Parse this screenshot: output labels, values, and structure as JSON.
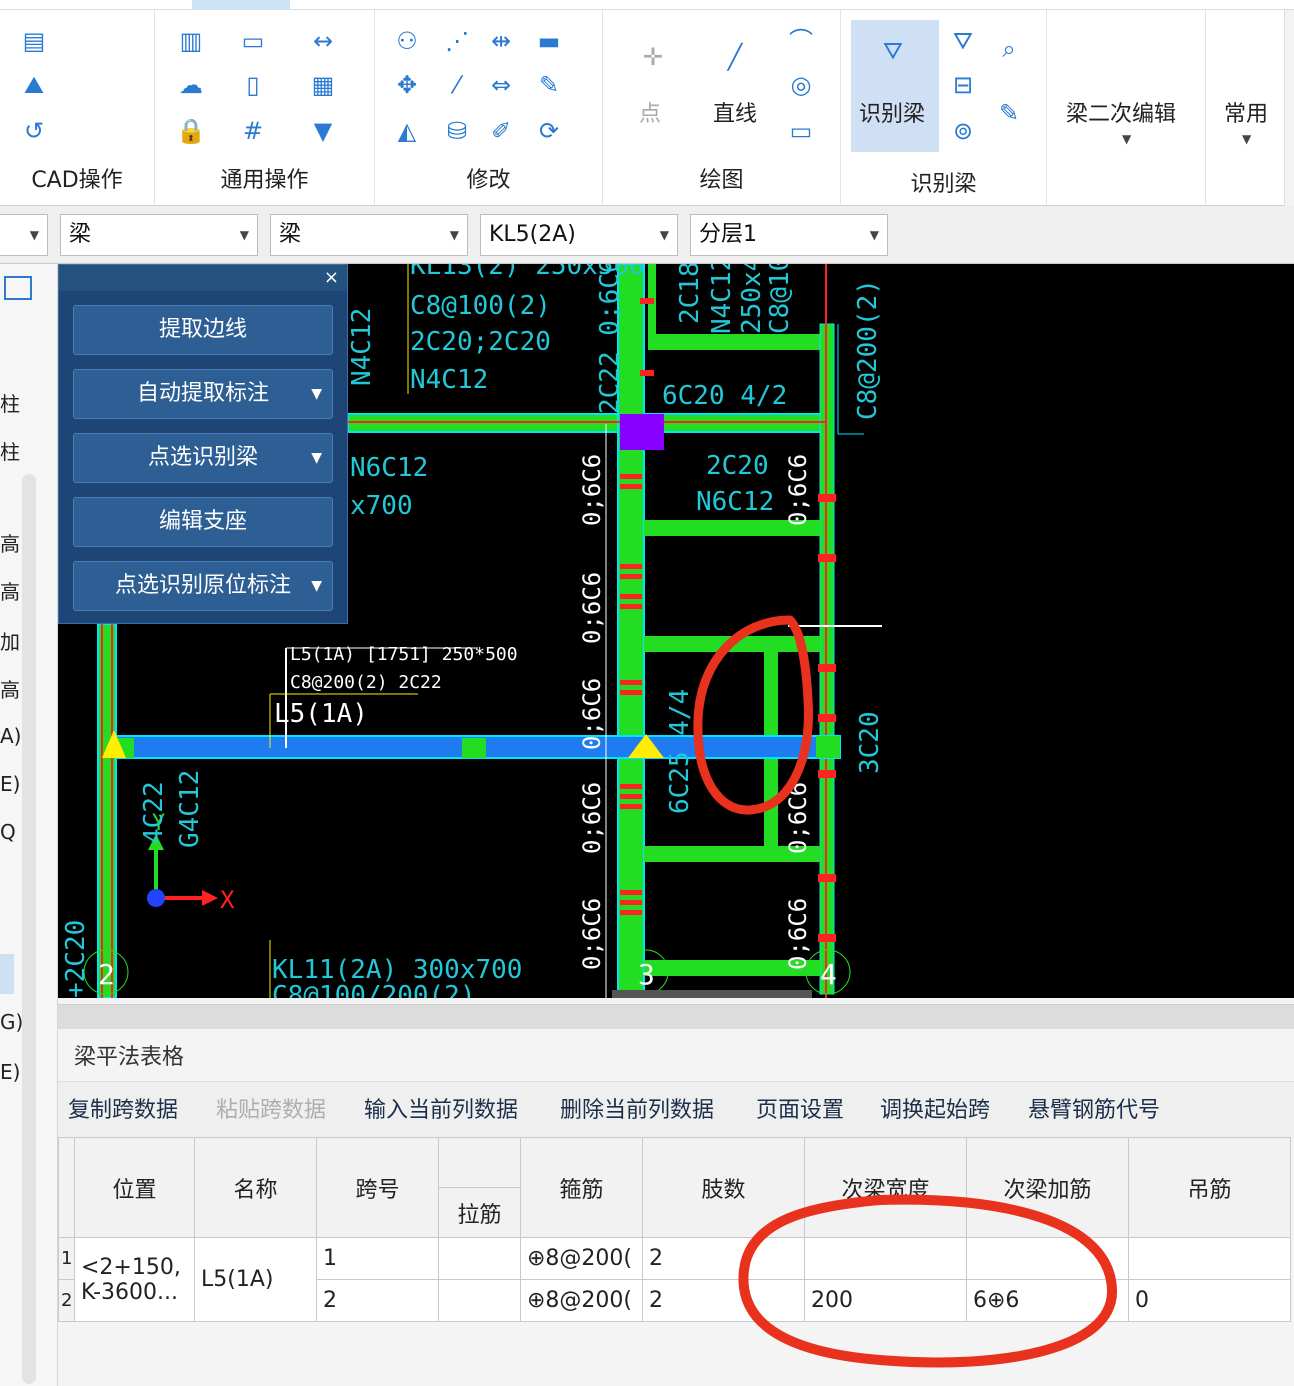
{
  "ribbon": {
    "groups": {
      "cad": "CAD操作",
      "general": "通用操作",
      "modify": "修改",
      "draw": "绘图",
      "identify": "识别梁"
    },
    "buttons": {
      "point": "点",
      "line": "直线",
      "identify_beam": "识别梁",
      "beam_secondary_edit": "梁二次编辑",
      "common": "常用"
    }
  },
  "combos": [
    "梁",
    "梁",
    "KL5(2A)",
    "分层1"
  ],
  "left_fragments": [
    "柱",
    "柱",
    "高",
    "高",
    "加",
    "高",
    "A)",
    "E)",
    "Q",
    "G)",
    "E)"
  ],
  "panel": {
    "close": "×",
    "buttons": [
      "提取边线",
      "自动提取标注",
      "点选识别梁",
      "编辑支座",
      "点选识别原位标注"
    ]
  },
  "canvas_text": {
    "t1": "KL13(2) 250x500",
    "t2": "C8@100(2)",
    "t3": "2C20;2C20",
    "t4": "N4C12",
    "t5": "N4C12",
    "t6": "2C22 0;6C6",
    "t7": "6C20 4/2",
    "t8": "2C18",
    "t9": "N4C12",
    "t10": "250x4",
    "t11": "C8@10",
    "t12": "C8@200(2)",
    "t13": "N6C12",
    "t14": "x700",
    "t15": "2C20",
    "t16": "N6C12",
    "t17": "0;6C6",
    "t18": "0;6C6",
    "t19": "0;6C6",
    "t20": "0;6C6",
    "t21": "0;6C6",
    "t22": "0;6C6",
    "t23": "0;6C6",
    "t24": "0;6C6",
    "t25": "L5(1A) [1751] 250*500",
    "t26": "C8@200(2) 2C22",
    "t27": "L5(1A)",
    "t28": "6C25 4/4",
    "t29": "3C20",
    "t30": "4C22",
    "t31": "G4C12",
    "t32": "KL11(2A) 300x700",
    "t33": "C8@100/200(2)",
    "t34": "+2C20",
    "axis_y": "Y",
    "axis_x": "X",
    "grid_2": "2",
    "grid_3": "3",
    "grid_4": "4"
  },
  "bottom": {
    "title": "梁平法表格",
    "tools": [
      "复制跨数据",
      "粘贴跨数据",
      "输入当前列数据",
      "删除当前列数据",
      "页面设置",
      "调换起始跨",
      "悬臂钢筋代号"
    ],
    "headers": [
      "位置",
      "名称",
      "跨号",
      "拉筋",
      "箍筋",
      "肢数",
      "次梁宽度",
      "次梁加筋",
      "吊筋"
    ],
    "rows": [
      {
        "num": "1",
        "pos": "<2+150,",
        "name": "L5(1A)",
        "span": "1",
        "tie": "",
        "stirrup": "⊕8@200(",
        "legs": "2",
        "width": "",
        "add": "",
        "hang": ""
      },
      {
        "num": "2",
        "pos": "K-3600...",
        "name": "",
        "span": "2",
        "tie": "",
        "stirrup": "⊕8@200(",
        "legs": "2",
        "width": "200",
        "add": "6⊕6",
        "hang": "0"
      }
    ]
  }
}
